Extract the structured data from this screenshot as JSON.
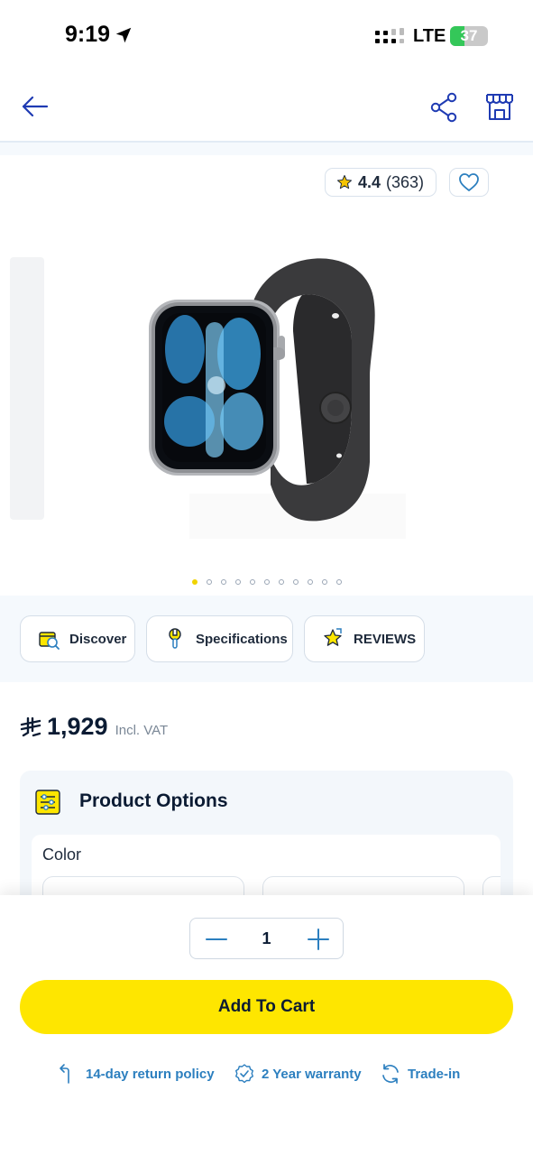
{
  "status_bar": {
    "time": "9:19",
    "network": "LTE",
    "battery_text": "37",
    "battery_level": 0.37
  },
  "nav": {
    "back_icon": "arrow-left-icon",
    "share_icon": "share-icon",
    "store_icon": "store-icon"
  },
  "gallery": {
    "rating": "4.4",
    "rating_count": "(363)",
    "image_count": 11,
    "active_index": 0
  },
  "tabs": [
    {
      "label": "Discover",
      "icon": "discover-icon"
    },
    {
      "label": "Specifications",
      "icon": "specifications-icon"
    },
    {
      "label": "REVIEWS",
      "icon": "reviews-icon"
    }
  ],
  "price": {
    "amount": "1,929",
    "vat_label": "Incl. VAT"
  },
  "options": {
    "title": "Product Options",
    "color_label": "Color"
  },
  "cart": {
    "quantity": "1",
    "add_label": "Add To Cart"
  },
  "perks": [
    {
      "label": "14-day return policy",
      "icon": "return-icon"
    },
    {
      "label": "2 Year warranty",
      "icon": "warranty-badge-icon"
    },
    {
      "label": "Trade-in",
      "icon": "trade-in-icon"
    }
  ],
  "colors": {
    "accent_yellow": "#fee600",
    "link_blue": "#2c7fbf",
    "text_dark": "#0b1b33",
    "nav_blue": "#1f3bb3"
  }
}
